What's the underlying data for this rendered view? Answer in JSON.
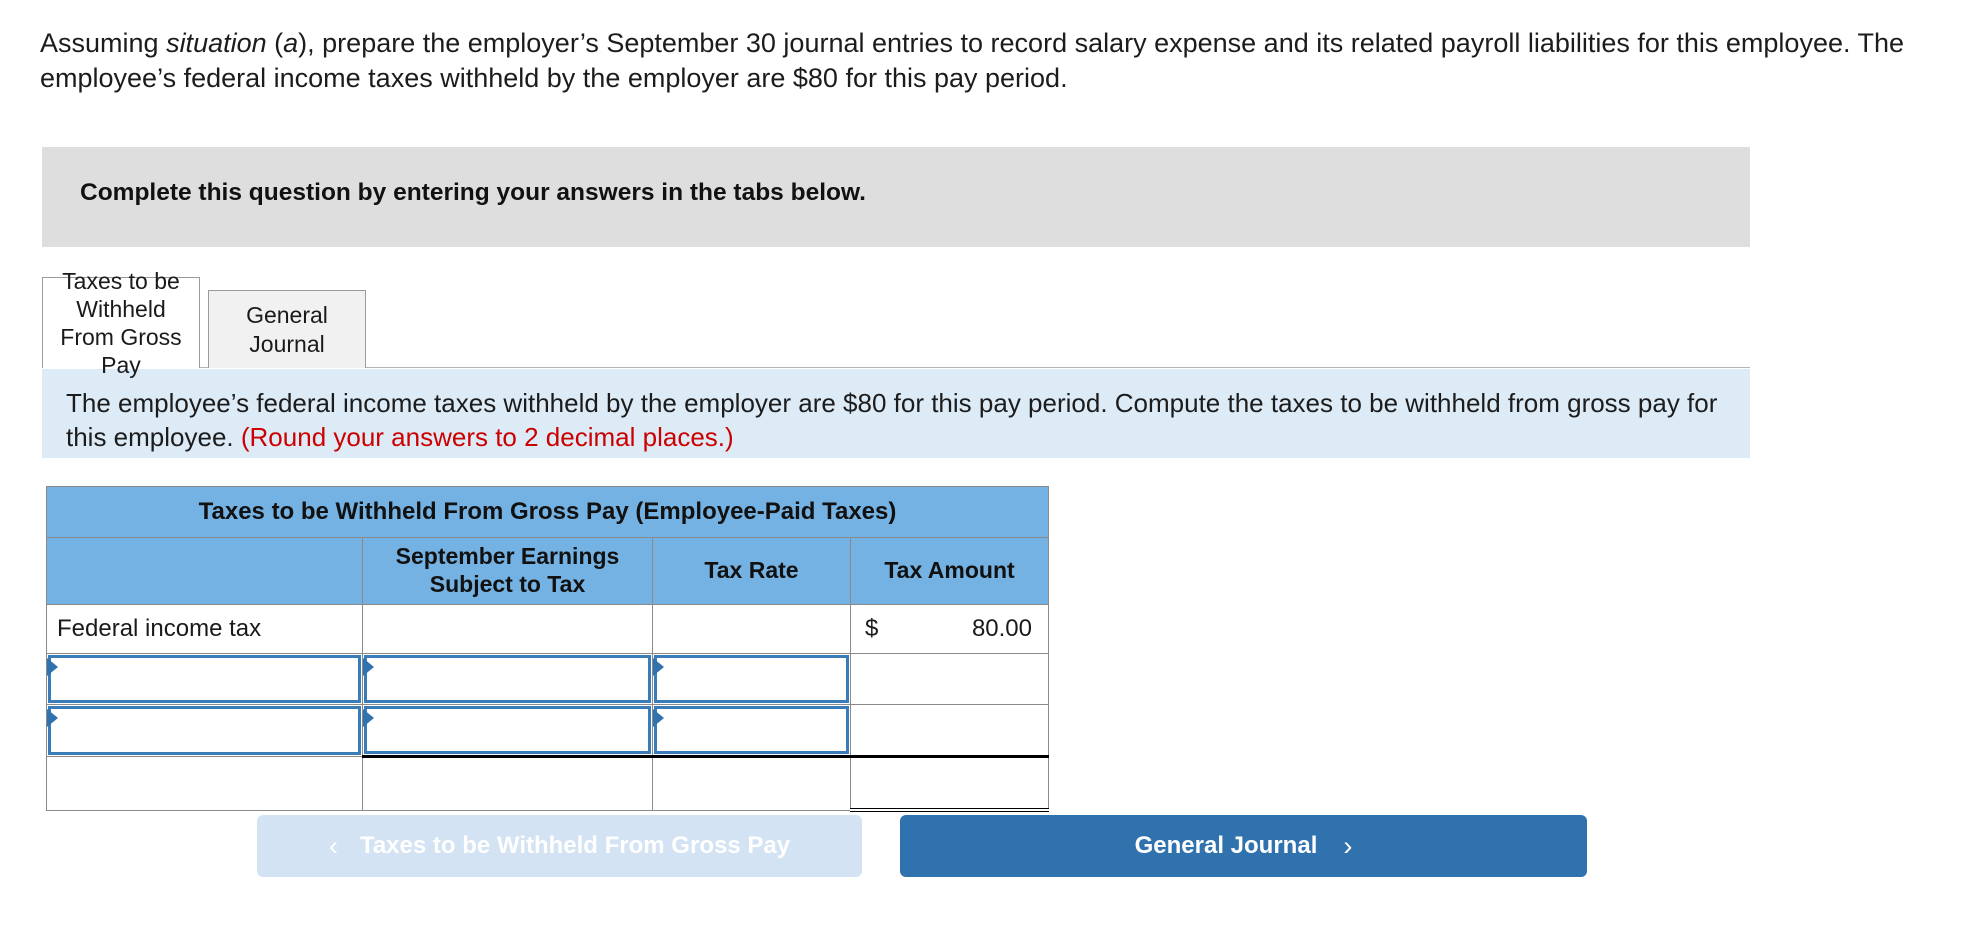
{
  "prompt": {
    "part1": "Assuming ",
    "italic": "situation",
    "part2": " (",
    "italic2": "a",
    "part3": "), prepare the employer’s September 30 journal entries to record salary expense and its related payroll liabilities for this employee. The employee’s federal income taxes withheld by the employer are $80 for this pay period."
  },
  "instruction_band": {
    "text": "Complete this question by entering your answers in the tabs below."
  },
  "tabs": [
    {
      "label": "Taxes to be Withheld From Gross Pay",
      "active": true
    },
    {
      "label": "General Journal",
      "active": false
    }
  ],
  "info_band": {
    "text": "The employee’s federal income taxes withheld by the employer are $80 for this pay period. Compute the taxes to be withheld from gross pay for this employee. ",
    "hint": "(Round your answers to 2 decimal places.)",
    "hint_color": "#cc0000"
  },
  "table": {
    "title": "Taxes to be Withheld From Gross Pay (Employee-Paid Taxes)",
    "headers": [
      "",
      "September Earnings Subject to Tax",
      "Tax Rate",
      "Tax Amount"
    ],
    "header_line1": [
      "",
      "September Earnings",
      "Tax Rate",
      "Tax Amount"
    ],
    "header_line2": [
      "",
      "Subject to Tax",
      "",
      ""
    ],
    "rows": [
      {
        "type": "static",
        "label": "Federal income tax",
        "earnings": "",
        "rate": "",
        "amount_symbol": "$",
        "amount_value": "80.00"
      },
      {
        "type": "dropdown",
        "label": "",
        "earnings": "",
        "rate": "",
        "amount": ""
      },
      {
        "type": "dropdown",
        "label": "",
        "earnings": "",
        "rate": "",
        "amount": ""
      },
      {
        "type": "total",
        "label": "",
        "earnings": "",
        "rate": "",
        "amount": ""
      }
    ]
  },
  "nav": {
    "prev_label": "Taxes to be Withheld From Gross Pay",
    "prev_chevron": "‹",
    "prev_disabled": true,
    "next_label": "General Journal",
    "next_chevron": "›"
  },
  "colors": {
    "table_header_blue": "#74b2e3",
    "info_band_blue": "#ddebf7",
    "gray_band": "#dedede",
    "accent_blue": "#2f72ae",
    "disabled_blue": "#d3e3f3",
    "red_hint": "#cc0000"
  }
}
